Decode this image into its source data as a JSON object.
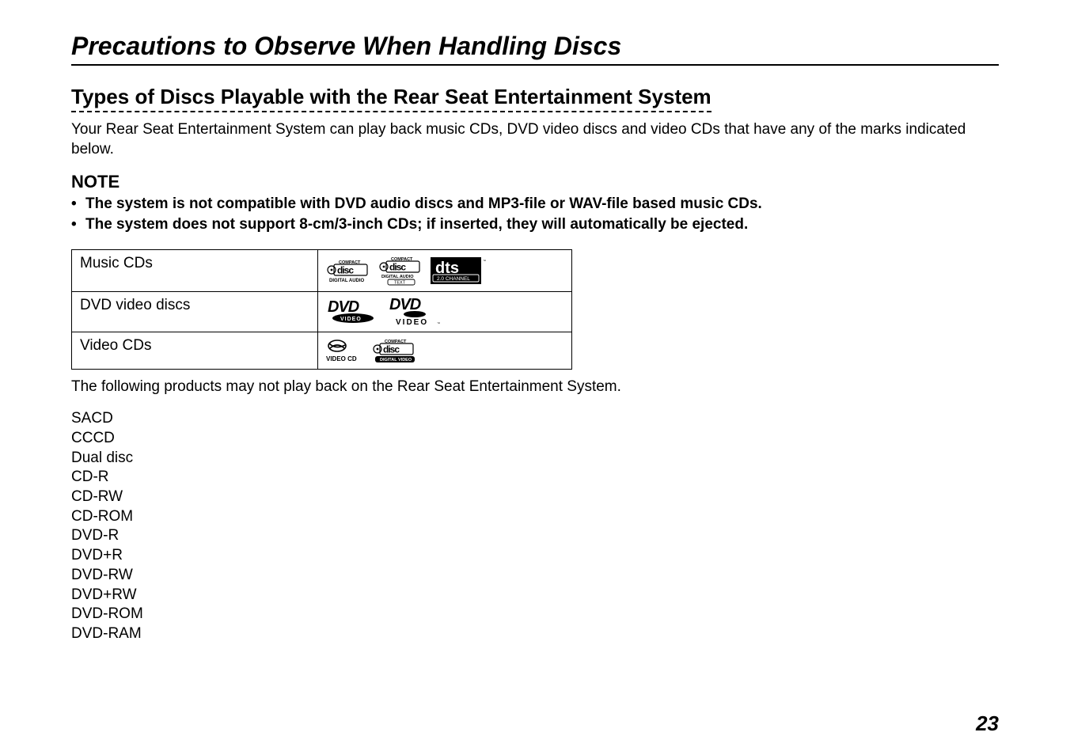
{
  "title": "Precautions to Observe When Handling Discs",
  "section_heading": "Types of Discs Playable with the Rear Seat Entertainment System",
  "intro": "Your Rear Seat Entertainment System can play back music CDs, DVD video discs and video CDs that have any of the marks indicated below.",
  "note_heading": "NOTE",
  "notes": [
    "The system is not compatible with DVD audio discs and MP3-file or WAV-file based music CDs.",
    "The system does not support 8-cm/3-inch CDs; if inserted, they will automatically be ejected."
  ],
  "disc_table": [
    {
      "label": "Music CDs",
      "logos": [
        "cd-digital-audio",
        "cd-digital-audio-text",
        "dts-20-channel"
      ]
    },
    {
      "label": "DVD video discs",
      "logos": [
        "dvd-video-oval",
        "dvd-video-caps"
      ]
    },
    {
      "label": "Video CDs",
      "logos": [
        "video-cd-script",
        "cd-digital-video"
      ]
    }
  ],
  "followup": "The following products may not play back on the Rear Seat Entertainment System.",
  "unsupported": [
    "SACD",
    "CCCD",
    "Dual disc",
    "CD-R",
    "CD-RW",
    "CD-ROM",
    "DVD-R",
    "DVD+R",
    "DVD-RW",
    "DVD+RW",
    "DVD-ROM",
    "DVD-RAM"
  ],
  "page_number": "23",
  "logo_alt": {
    "cd-digital-audio": "Compact Disc Digital Audio",
    "cd-digital-audio-text": "Compact Disc Digital Audio Text",
    "dts-20-channel": "dts 2.0 Channel",
    "dvd-video-oval": "DVD Video",
    "dvd-video-caps": "DVD VIDEO",
    "video-cd-script": "Video CD",
    "cd-digital-video": "Compact Disc Digital Video"
  }
}
